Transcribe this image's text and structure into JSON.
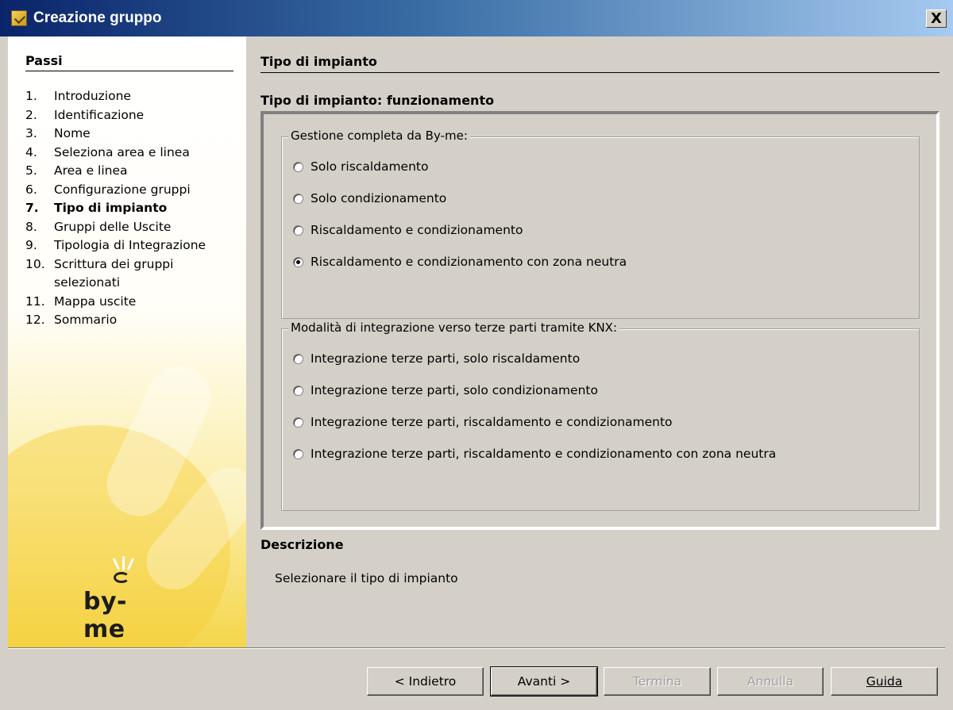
{
  "window": {
    "title": "Creazione gruppo",
    "close_label": "X"
  },
  "sidebar": {
    "title": "Passi",
    "steps": [
      {
        "num": "1.",
        "label": "Introduzione"
      },
      {
        "num": "2.",
        "label": "Identificazione"
      },
      {
        "num": "3.",
        "label": "Nome"
      },
      {
        "num": "4.",
        "label": "Seleziona area e linea"
      },
      {
        "num": "5.",
        "label": "Area e linea"
      },
      {
        "num": "6.",
        "label": "Configurazione gruppi"
      },
      {
        "num": "7.",
        "label": "Tipo di impianto"
      },
      {
        "num": "8.",
        "label": "Gruppi delle Uscite"
      },
      {
        "num": "9.",
        "label": "Tipologia di Integrazione"
      },
      {
        "num": "10.",
        "label": "Scrittura dei gruppi selezionati"
      },
      {
        "num": "11.",
        "label": "Mappa uscite"
      },
      {
        "num": "12.",
        "label": "Sommario"
      }
    ],
    "current_step": 7,
    "logo_text": "by-me"
  },
  "main": {
    "section_title": "Tipo di impianto",
    "subsection_title": "Tipo di impianto: funzionamento",
    "group1": {
      "legend": "Gestione completa da By-me:",
      "options": [
        "Solo riscaldamento",
        "Solo condizionamento",
        "Riscaldamento e condizionamento",
        "Riscaldamento e condizionamento con zona neutra"
      ],
      "selected_index": 3
    },
    "group2": {
      "legend": "Modalità di integrazione verso terze parti tramite KNX:",
      "options": [
        "Integrazione terze parti, solo riscaldamento",
        "Integrazione terze parti, solo condizionamento",
        "Integrazione terze parti, riscaldamento e condizionamento",
        "Integrazione terze parti, riscaldamento e condizionamento con zona neutra"
      ]
    },
    "description_title": "Descrizione",
    "description_text": "Selezionare il tipo di impianto"
  },
  "buttons": {
    "back": "< Indietro",
    "next": "Avanti >",
    "finish": "Termina",
    "cancel": "Annulla",
    "help": "Guida"
  }
}
